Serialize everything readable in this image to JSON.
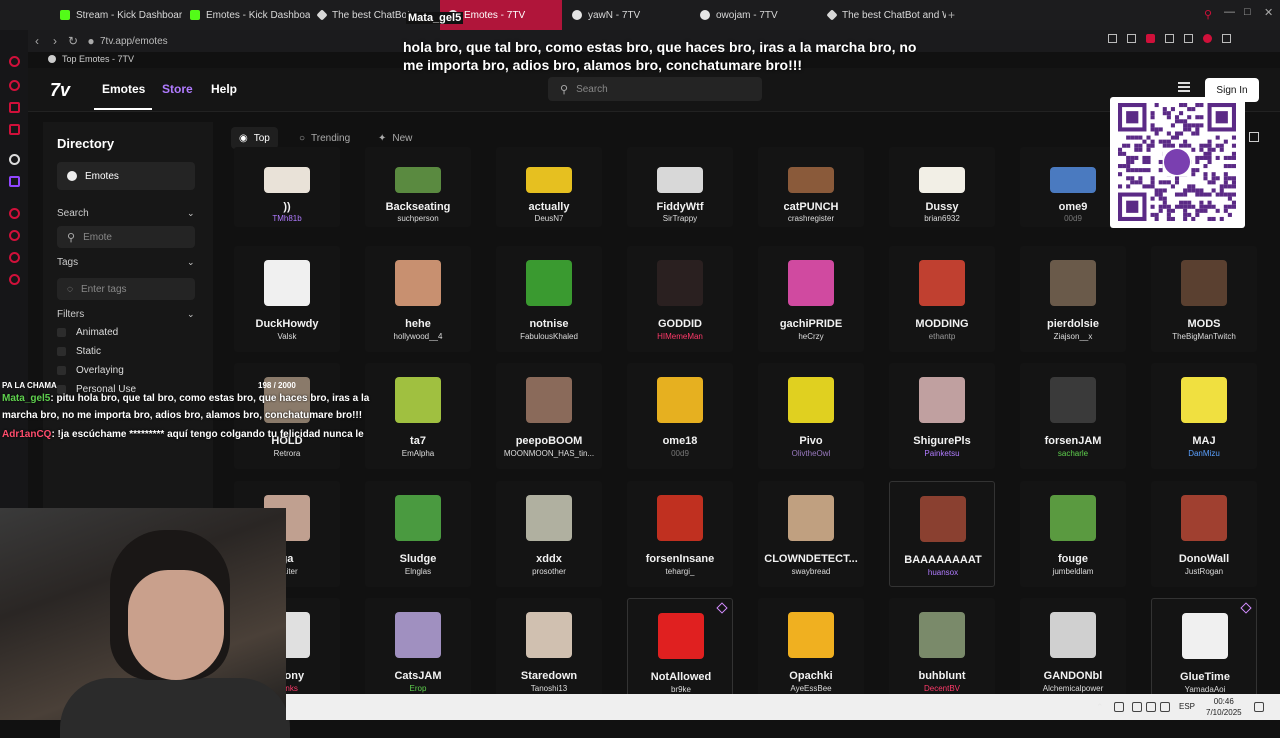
{
  "browser": {
    "tabs": [
      {
        "label": "Stream - Kick Dashboard",
        "icon": "kick-icon"
      },
      {
        "label": "Emotes - Kick Dashboard",
        "icon": "kick-icon"
      },
      {
        "label": "The best ChatBot",
        "icon": "chatbot-icon"
      },
      {
        "label": "Emotes - 7TV",
        "icon": "7tv-icon"
      },
      {
        "label": "yawN - 7TV",
        "icon": "7tv-icon"
      },
      {
        "label": "owojam - 7TV",
        "icon": "7tv-icon"
      },
      {
        "label": "The best ChatBot and W",
        "icon": "chatbot-icon"
      }
    ],
    "url": "7tv.app/emotes",
    "bookmark": "Top Emotes - 7TV"
  },
  "site": {
    "nav": {
      "emotes": "Emotes",
      "store": "Store",
      "help": "Help"
    },
    "search_placeholder": "Search",
    "sign_in": "Sign In"
  },
  "sidebar": {
    "title": "Directory",
    "emotes_item": "Emotes",
    "search_label": "Search",
    "search_placeholder": "Emote",
    "tags_label": "Tags",
    "tags_placeholder": "Enter tags",
    "filters_label": "Filters",
    "filters": [
      "Animated",
      "Static",
      "Overlaying",
      "Personal Use"
    ]
  },
  "categories": {
    "top": "Top",
    "trending": "Trending",
    "new": "New"
  },
  "emotes": [
    {
      "name": "))",
      "author": "TMh81b",
      "color": "#e9e2d8",
      "author_color": "#b07bff"
    },
    {
      "name": "Backseating",
      "author": "suchperson",
      "color": "#5a8a40"
    },
    {
      "name": "actually",
      "author": "DeusN7",
      "color": "#e6c020"
    },
    {
      "name": "FiddyWtf",
      "author": "SirTrappy",
      "color": "#d8d8d8"
    },
    {
      "name": "catPUNCH",
      "author": "crashregister",
      "color": "#8a5a3a"
    },
    {
      "name": "Dussy",
      "author": "brian6932",
      "color": "#f2efe6"
    },
    {
      "name": "ome9",
      "author": "00d9",
      "color": "#4a7ac0",
      "author_color": "#777777"
    },
    {
      "name": "DuckHowdy",
      "author": "Valsk",
      "color": "#f0f0f0"
    },
    {
      "name": "hehe",
      "author": "hollywood__4",
      "color": "#c89070"
    },
    {
      "name": "notnise",
      "author": "FabulousKhaled",
      "color": "#3a9a30"
    },
    {
      "name": "GODDID",
      "author": "HIMemeMan",
      "color": "#2a2020",
      "author_color": "#ff3a6a"
    },
    {
      "name": "gachiPRIDE",
      "author": "heCrzy",
      "color": "#d04aa0"
    },
    {
      "name": "MODDING",
      "author": "ethantp",
      "color": "#c04030",
      "author_color": "#9a9a9a"
    },
    {
      "name": "pierdolsie",
      "author": "Ziajson__x",
      "color": "#6a5a4a"
    },
    {
      "name": "MODS",
      "author": "TheBigManTwitch",
      "color": "#5a4030"
    },
    {
      "name": "HOLD",
      "author": "Retrora",
      "color": "#8a7a6a"
    },
    {
      "name": "ta7",
      "author": "EmAlpha",
      "color": "#a0c040"
    },
    {
      "name": "peepoBOOM",
      "author": "MOONMOON_HAS_tin...",
      "color": "#8a6a5a"
    },
    {
      "name": "ome18",
      "author": "00d9",
      "color": "#e6b020",
      "author_color": "#777777"
    },
    {
      "name": "Pivo",
      "author": "OlivtheOwl",
      "color": "#e0d020",
      "author_color": "#9a7ac0"
    },
    {
      "name": "ShigurePls",
      "author": "Painketsu",
      "color": "#c0a0a0",
      "author_color": "#b07bff"
    },
    {
      "name": "forsenJAM",
      "author": "sacharle",
      "color": "#3a3a3a",
      "author_color": "#5fd04e"
    },
    {
      "name": "MAJ",
      "author": "DanMizu",
      "color": "#f0e040",
      "author_color": "#5aa0ff"
    },
    {
      "name": "ga",
      "author": "waiter",
      "color": "#c0a090"
    },
    {
      "name": "Sludge",
      "author": "Elnglas",
      "color": "#4a9a40"
    },
    {
      "name": "xddx",
      "author": "prosother",
      "color": "#b0b0a0"
    },
    {
      "name": "forsenInsane",
      "author": "tehargi_",
      "color": "#c03020"
    },
    {
      "name": "CLOWNDETECT...",
      "author": "swaybread",
      "color": "#c0a080"
    },
    {
      "name": "BAAAAAAAAT",
      "author": "huansox",
      "color": "#8a4030",
      "author_color": "#b07bff"
    },
    {
      "name": "fouge",
      "author": "jumbeldlam",
      "color": "#5a9a40"
    },
    {
      "name": "DonoWall",
      "author": "JustRogan",
      "color": "#a04030"
    },
    {
      "name": "Agony",
      "author": "Fonks",
      "color": "#e0e0e0",
      "author_color": "#ff3a6a"
    },
    {
      "name": "CatsJAM",
      "author": "Erop",
      "color": "#a090c0",
      "author_color": "#5fd04e"
    },
    {
      "name": "Staredown",
      "author": "Tanoshi13",
      "color": "#d0c0b0"
    },
    {
      "name": "NotAllowed",
      "author": "br9ke",
      "color": "#e02020"
    },
    {
      "name": "Opachki",
      "author": "AyeEssBee",
      "color": "#f0b020"
    },
    {
      "name": "buhblunt",
      "author": "DecentBV",
      "color": "#7a8a6a",
      "author_color": "#ff3a6a"
    },
    {
      "name": "GANDONbl",
      "author": "Alchemicalpower",
      "color": "#d0d0d0"
    },
    {
      "name": "GlueTime",
      "author": "YamadaAoi",
      "color": "#f0f0f0"
    }
  ],
  "overlay": {
    "top_user": "Mata_gel5",
    "top_message": "hola bro, que tal bro, como estas bro, que haces bro, iras a la marcha bro, no me importa bro, adios bro, alamos bro, conchatumare bro!!!",
    "chat_title": "PA LA CHAMA",
    "chat_counter": "198 / 2000",
    "messages": [
      {
        "user": "Mata_gel5",
        "text": ": pitu hola bro, que tal bro, como estas bro, que haces bro, iras a la marcha bro, no me importa bro, adios bro, alamos bro, conchatumare bro!!!"
      },
      {
        "user": "Adr1anCQ",
        "text": ": !ja escúchame ********* aquí tengo colgando tu felicidad nunca le"
      }
    ]
  },
  "taskbar": {
    "lang": "ESP",
    "time": "00:46",
    "date": "7/10/2025"
  }
}
